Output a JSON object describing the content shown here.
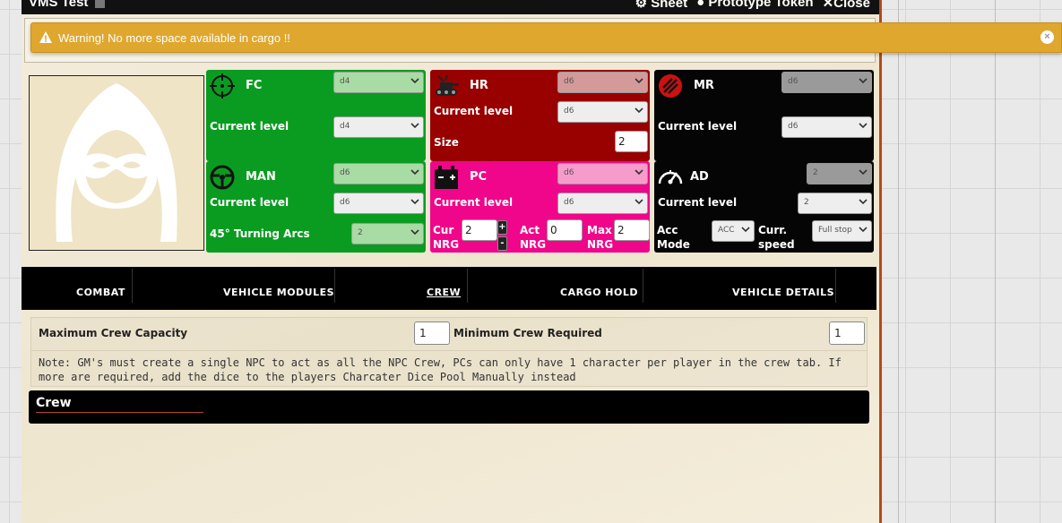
{
  "window": {
    "title": "VMS Test",
    "controls": {
      "sheet": "Sheet",
      "prototype_token": "Prototype Token",
      "close": "Close"
    }
  },
  "warning": {
    "text": "Warning! No more space available in cargo !!",
    "close_glyph": "×"
  },
  "stats": {
    "fc": {
      "name": "FC",
      "die": "d4",
      "current_level_label": "Current level",
      "current_level": "d4",
      "color": "#0a9c21",
      "icon": "crosshair-icon"
    },
    "hr": {
      "name": "HR",
      "die": "d6",
      "current_level_label": "Current level",
      "current_level": "d6",
      "size_label": "Size",
      "size": "2",
      "color": "#990000",
      "icon": "tank-icon"
    },
    "mr": {
      "name": "MR",
      "die": "d6",
      "current_level_label": "Current level",
      "current_level": "d6",
      "color": "#050505",
      "icon": "missile-icon"
    },
    "man": {
      "name": "MAN",
      "die": "d6",
      "current_level_label": "Current level",
      "current_level": "d6",
      "turning_label": "45° Turning Arcs",
      "turning": "2",
      "color": "#0a9c21",
      "icon": "steering-wheel-icon"
    },
    "pc": {
      "name": "PC",
      "die": "d6",
      "current_level_label": "Current level",
      "current_level": "d6",
      "cur_label_1": "Cur",
      "cur_label_2": "NRG",
      "cur": "2",
      "act_label_1": "Act",
      "act_label_2": "NRG",
      "act": "0",
      "max_label_1": "Max",
      "max_label_2": "NRG",
      "max": "2",
      "plus": "+",
      "minus": "-",
      "color": "#f0068a",
      "icon": "battery-icon"
    },
    "ad": {
      "name": "AD",
      "die": "2",
      "current_level_label": "Current level",
      "current_level": "2",
      "acc_label_1": "Acc",
      "acc_label_2": "Mode",
      "acc_mode": "ACC",
      "speed_label_1": "Curr.",
      "speed_label_2": "speed",
      "speed": "Full stop",
      "color": "#050505",
      "icon": "speedometer-icon"
    }
  },
  "tabs": [
    {
      "label": "COMBAT"
    },
    {
      "label": "VEHICLE MODULES"
    },
    {
      "label": "CREW",
      "active": true
    },
    {
      "label": "CARGO HOLD"
    },
    {
      "label": "VEHICLE DETAILS"
    }
  ],
  "crew": {
    "max_capacity_label": "Maximum Crew Capacity",
    "max_capacity": "1",
    "min_required_label": "Minimum Crew Required",
    "min_required": "1",
    "note": "Note: GM's must create a single NPC to act as all the NPC Crew, PCs can only have 1 character per player in the crew tab. If more are required, add the dice to the players Charcater Dice Pool Manually instead",
    "section_title": "Crew"
  }
}
